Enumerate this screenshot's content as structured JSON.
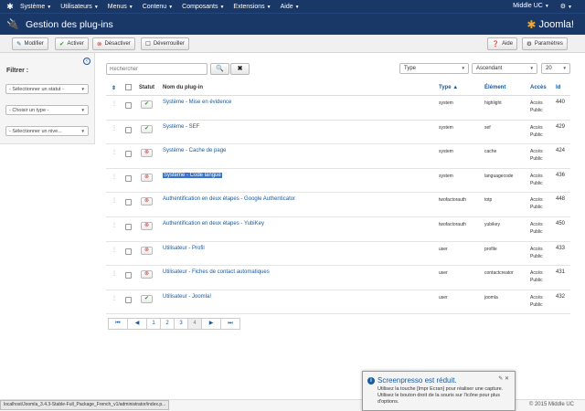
{
  "topnav": {
    "logo_icon": "joomla-icon",
    "menus": [
      "Système",
      "Utilisateurs",
      "Menus",
      "Contenu",
      "Composants",
      "Extensions",
      "Aide"
    ],
    "user": "Middle UC",
    "settings_icon": "gear-icon"
  },
  "header": {
    "title": "Gestion des plug-ins",
    "title_icon": "plug-icon",
    "brand": "Joomla!"
  },
  "toolbar": {
    "modifier": "Modifier",
    "activer": "Activer",
    "desactiver": "Désactiver",
    "deverrouiller": "Déverrouiller",
    "aide": "Aide",
    "parametres": "Paramètres"
  },
  "sidebar": {
    "filter_title": "Filtrer :",
    "status_select": "- Sélectionner un statut -",
    "type_select": "- Choisir un type -",
    "level_select": "- Sélectionner un nive..."
  },
  "search": {
    "placeholder": "Rechercher",
    "search_icon": "search-icon",
    "clear_icon": "close-icon"
  },
  "list_controls": {
    "order_field": "Type",
    "order_dir": "Ascendant",
    "limit": "20"
  },
  "table": {
    "headers": {
      "status": "Statut",
      "name": "Nom du plug-in",
      "type": "Type",
      "element": "Élément",
      "access": "Accès",
      "id": "Id"
    },
    "rows": [
      {
        "enabled": true,
        "name": "Système - Mise en évidence",
        "type": "system",
        "element": "highlight",
        "access": "Accès Public",
        "id": "440"
      },
      {
        "enabled": true,
        "name": "Système - SEF",
        "type": "system",
        "element": "sef",
        "access": "Accès Public",
        "id": "429"
      },
      {
        "enabled": false,
        "name": "Système - Cache de page",
        "type": "system",
        "element": "cache",
        "access": "Accès Public",
        "id": "424"
      },
      {
        "enabled": false,
        "name": "Système - Code langue",
        "type": "system",
        "element": "languagecode",
        "access": "Accès Public",
        "id": "436"
      },
      {
        "enabled": false,
        "name": "Authentification en deux étapes - Google Authenticator",
        "type": "twofactorauth",
        "element": "totp",
        "access": "Accès Public",
        "id": "448"
      },
      {
        "enabled": false,
        "name": "Authentification en deux étapes - YubiKey",
        "type": "twofactorauth",
        "element": "yubikey",
        "access": "Accès Public",
        "id": "450"
      },
      {
        "enabled": false,
        "name": "Utilisateur - Profil",
        "type": "user",
        "element": "profile",
        "access": "Accès Public",
        "id": "433"
      },
      {
        "enabled": false,
        "name": "Utilisateur - Fiches de contact automatiques",
        "type": "user",
        "element": "contactcreator",
        "access": "Accès Public",
        "id": "431"
      },
      {
        "enabled": true,
        "name": "Utilisateur - Joomla!",
        "type": "user",
        "element": "joomla",
        "access": "Accès Public",
        "id": "432"
      }
    ]
  },
  "pagination": {
    "pages": [
      "1",
      "2",
      "3",
      "4"
    ],
    "active": "4"
  },
  "statusbar": {
    "url": "localhost/Joomla_3.4.3-Stable-Full_Package_French_v1/administrator/index.p...",
    "copyright": "© 2015 Middle UC"
  },
  "toast": {
    "title": "Screenpresso est réduit.",
    "line1": "Utilisez la touche [Impr Ecran] pour réaliser une capture.",
    "line2": "Utilisez le bouton droit de la souris sur l'icône pour plus d'options."
  }
}
